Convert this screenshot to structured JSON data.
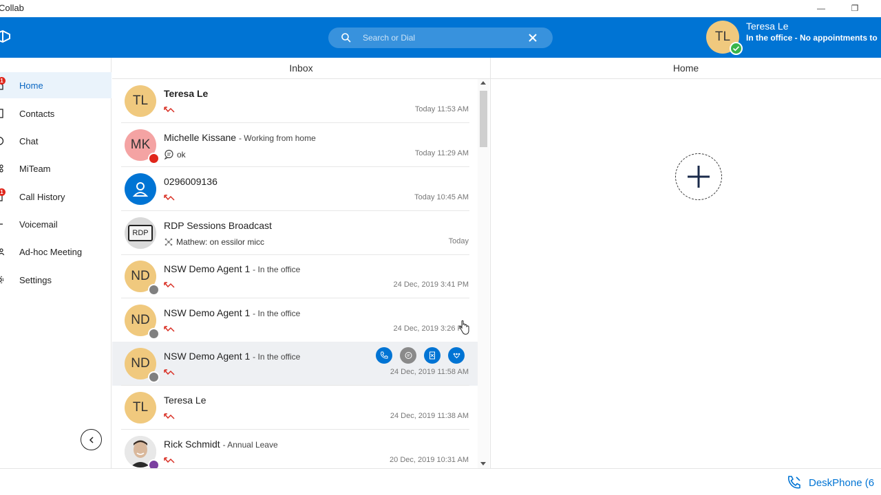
{
  "window": {
    "title": "Collab",
    "controls": {
      "minimize": "—",
      "restore": "❐"
    }
  },
  "header": {
    "search_placeholder": "Search or Dial",
    "user": {
      "initials": "TL",
      "name": "Teresa Le",
      "presence": "In the office - No appointments to",
      "status_color": "#39b54a"
    }
  },
  "sidebar": {
    "items": [
      {
        "label": "Home",
        "active": true,
        "badge": "1",
        "icon": "home-icon"
      },
      {
        "label": "Contacts",
        "active": false,
        "badge": "",
        "icon": "contacts-icon"
      },
      {
        "label": "Chat",
        "active": false,
        "badge": "",
        "icon": "chat-icon"
      },
      {
        "label": "MiTeam",
        "active": false,
        "badge": "",
        "icon": "miteam-icon"
      },
      {
        "label": "Call History",
        "active": false,
        "badge": "1",
        "icon": "call-history-icon"
      },
      {
        "label": "Voicemail",
        "active": false,
        "badge": "",
        "icon": "voicemail-icon"
      },
      {
        "label": "Ad-hoc Meeting",
        "active": false,
        "badge": "",
        "icon": "meeting-icon"
      },
      {
        "label": "Settings",
        "active": false,
        "badge": "",
        "icon": "gear-icon"
      }
    ]
  },
  "inbox": {
    "title": "Inbox",
    "rows": [
      {
        "initials": "TL",
        "avatar": "yellow",
        "name": "Teresa Le",
        "bold": true,
        "status": "",
        "sub_type": "missed",
        "sub_text": "",
        "time": "Today 11:53 AM",
        "presence": ""
      },
      {
        "initials": "MK",
        "avatar": "pink",
        "name": "Michelle Kissane",
        "bold": false,
        "status": "- Working from home",
        "sub_type": "chat",
        "sub_text": "ok",
        "time": "Today 11:29 AM",
        "presence": "red"
      },
      {
        "initials": "",
        "avatar": "blue",
        "name": "0296009136",
        "bold": false,
        "status": "",
        "sub_type": "missed",
        "sub_text": "",
        "time": "Today 10:45 AM",
        "presence": ""
      },
      {
        "initials": "RDP",
        "avatar": "photo",
        "name": "RDP Sessions Broadcast",
        "bold": false,
        "status": "",
        "sub_type": "team",
        "sub_text": "Mathew: on essilor micc",
        "time": "Today",
        "presence": ""
      },
      {
        "initials": "ND",
        "avatar": "yellow",
        "name": "NSW Demo Agent 1",
        "bold": false,
        "status": "- In the office",
        "sub_type": "missed",
        "sub_text": "",
        "time": "24 Dec, 2019 3:41 PM",
        "presence": "grey"
      },
      {
        "initials": "ND",
        "avatar": "yellow",
        "name": "NSW Demo Agent 1",
        "bold": false,
        "status": "- In the office",
        "sub_type": "missed",
        "sub_text": "",
        "time": "24 Dec, 2019 3:26 PM",
        "presence": "grey"
      },
      {
        "initials": "ND",
        "avatar": "yellow",
        "name": "NSW Demo Agent 1",
        "bold": false,
        "status": "- In the office",
        "sub_type": "missed",
        "sub_text": "",
        "time": "24 Dec, 2019 11:58 AM",
        "presence": "grey",
        "hover": true
      },
      {
        "initials": "TL",
        "avatar": "yellow",
        "name": "Teresa Le",
        "bold": false,
        "status": "",
        "sub_type": "missed",
        "sub_text": "",
        "time": "24 Dec, 2019 11:38 AM",
        "presence": ""
      },
      {
        "initials": "",
        "avatar": "photo",
        "name": "Rick Schmidt",
        "bold": false,
        "status": "- Annual Leave",
        "sub_type": "missed",
        "sub_text": "",
        "time": "20 Dec, 2019 10:31 AM",
        "presence": "purple"
      }
    ],
    "hover_actions": [
      "phone-icon",
      "chat-icon",
      "meeting-icon",
      "team-icon"
    ]
  },
  "home": {
    "title": "Home"
  },
  "footer": {
    "deskphone_label": "DeskPhone (6"
  },
  "colors": {
    "brand": "#0074d4",
    "missed": "#d93025",
    "active_nav_bg": "#eaf3fb"
  }
}
